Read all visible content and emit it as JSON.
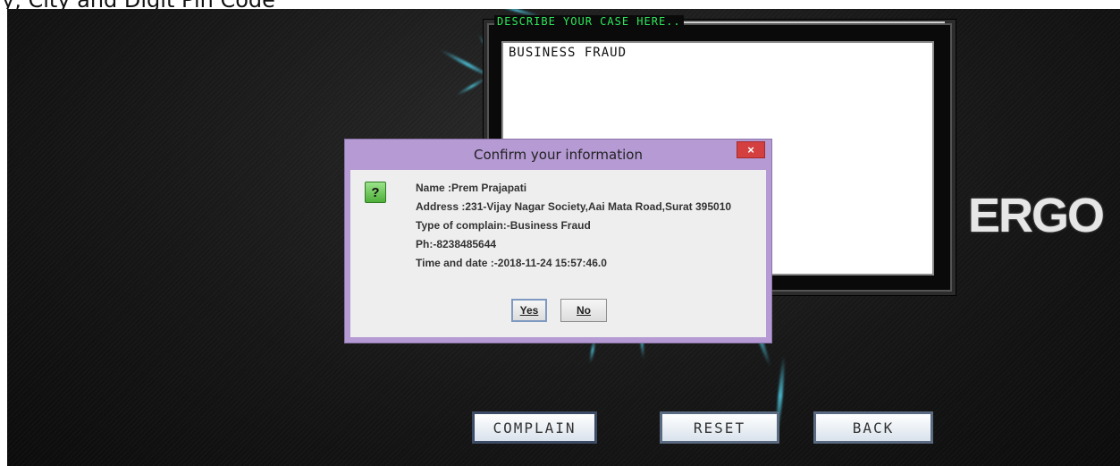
{
  "top_strip_text": "y, City and Digit Pin Code",
  "case_box": {
    "legend": "DESCRIBE YOUR CASE HERE..",
    "text": "BUSINESS FRAUD"
  },
  "logo_text": "ERGO",
  "buttons": {
    "complain": "COMPLAIN",
    "reset": "RESET",
    "back": "BACK"
  },
  "dialog": {
    "title": "Confirm your information",
    "close_symbol": "×",
    "icon_symbol": "?",
    "lines": {
      "name": "Name :Prem Prajapati",
      "address": "Address :231-Vijay Nagar Society,Aai Mata Road,Surat 395010",
      "type": "Type of complain:-Business Fraud",
      "phone": "Ph:-8238485644",
      "time": "Time and date :-2018-11-24 15:57:46.0"
    },
    "yes_label": "Yes",
    "no_label": "No"
  },
  "colors": {
    "legend_green": "#2ee85a",
    "dialog_frame": "#b59ad3",
    "close_red": "#d44040"
  }
}
